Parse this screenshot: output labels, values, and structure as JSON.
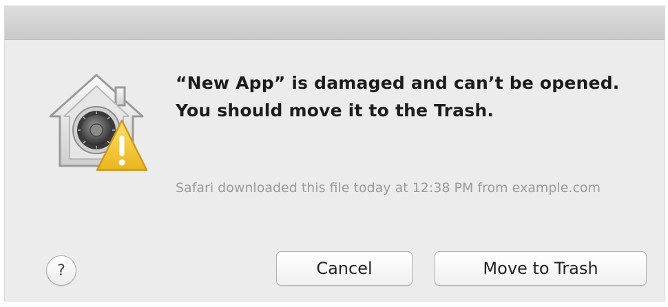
{
  "dialog": {
    "message": "“New App” is damaged and can’t be opened. You should move it to the Trash.",
    "info": "Safari downloaded this file today at 12:38 PM from example.com",
    "icon": "gatekeeper-warning-icon",
    "help_symbol": "?",
    "buttons": {
      "cancel": "Cancel",
      "move_to_trash": "Move to Trash"
    }
  },
  "colors": {
    "dialog_background": "#ececec",
    "warning_yellow": "#f4c531",
    "secondary_text": "#9b9b9b"
  }
}
